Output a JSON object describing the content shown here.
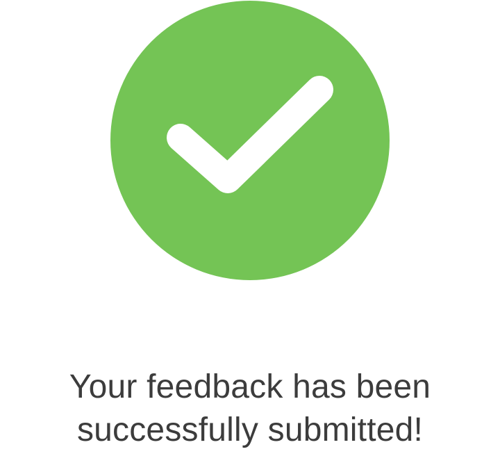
{
  "success": {
    "icon": "check-circle-icon",
    "circle_color": "#74c455",
    "check_color": "#ffffff"
  },
  "message": {
    "line1": "Your feedback has been",
    "line2": "successfully submitted!",
    "text_color": "#3c3c3c"
  }
}
